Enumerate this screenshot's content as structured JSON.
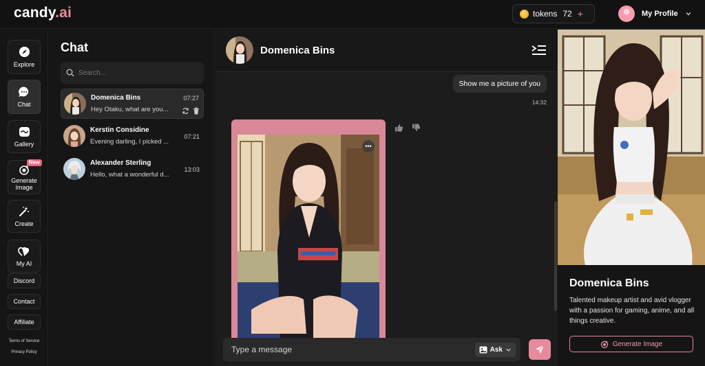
{
  "brand": {
    "name": "candy",
    "suffix": ".ai"
  },
  "header": {
    "tokens_label": "tokens",
    "tokens_count": "72",
    "tokens_plus": "+",
    "profile_label": "My Profile"
  },
  "rail": {
    "items": [
      {
        "label": "Explore",
        "icon": "compass-icon"
      },
      {
        "label": "Chat",
        "icon": "chat-bubble-icon"
      },
      {
        "label": "Gallery",
        "icon": "gallery-icon"
      },
      {
        "label": "Generate Image",
        "icon": "sparkle-target-icon",
        "badge": "New"
      },
      {
        "label": "Create",
        "icon": "magic-wand-icon"
      },
      {
        "label": "My AI",
        "icon": "hearts-icon"
      }
    ],
    "links": [
      "Discord",
      "Contact",
      "Affiliate"
    ],
    "legal": [
      "Terms of Service",
      "Privacy Policy"
    ]
  },
  "chatlist": {
    "title": "Chat",
    "search_placeholder": "Search...",
    "conversations": [
      {
        "name": "Domenica Bins",
        "preview": "Hey Otaku, what are you...",
        "time": "07:27"
      },
      {
        "name": "Kerstin Considine",
        "preview": "Evening darling, I picked ...",
        "time": "07:21"
      },
      {
        "name": "Alexander Sterling",
        "preview": "Hello, what a wonderful d...",
        "time": "13:03"
      }
    ]
  },
  "chat": {
    "name": "Domenica Bins",
    "messages": [
      {
        "text": "Show me a picture of you",
        "time": "14:32"
      }
    ],
    "composer_placeholder": "Type a message",
    "ask_label": "Ask"
  },
  "profile": {
    "name": "Domenica Bins",
    "description": "Talented makeup artist and avid vlogger with a passion for gaming, anime, and all things creative.",
    "generate_label": "Generate Image"
  },
  "colors": {
    "accent": "#e88a9b",
    "background": "#131313",
    "panel": "#161616"
  }
}
